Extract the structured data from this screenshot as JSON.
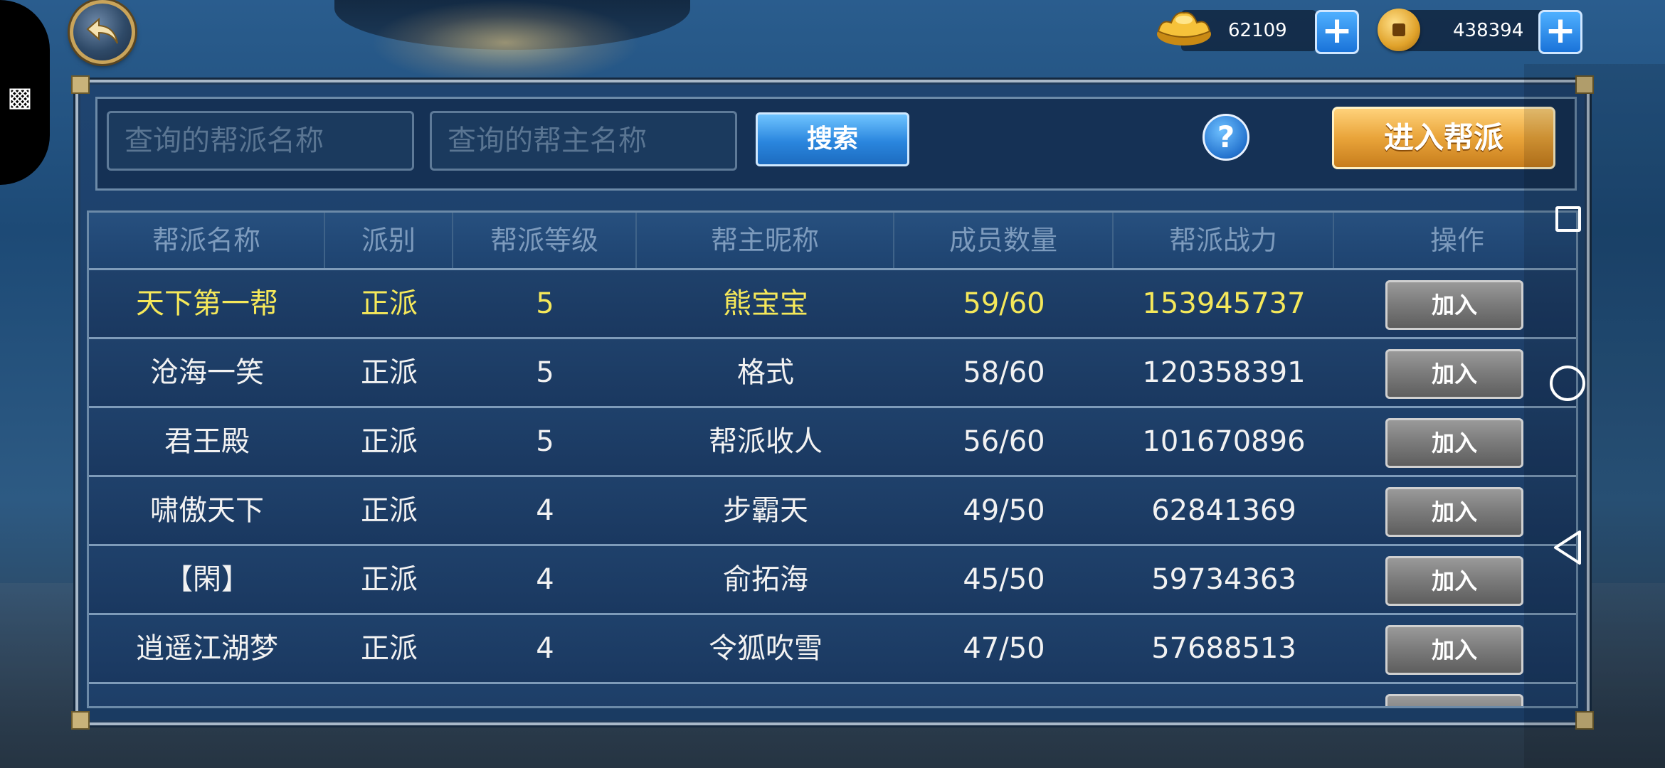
{
  "currencies": [
    {
      "name": "gold-ingot",
      "value": "62109"
    },
    {
      "name": "copper-coin",
      "value": "438394"
    }
  ],
  "search": {
    "guild_name_placeholder": "查询的帮派名称",
    "leader_name_placeholder": "查询的帮主名称",
    "search_label": "搜索",
    "help_label": "?",
    "enter_label": "进入帮派"
  },
  "table": {
    "headers": [
      "帮派名称",
      "派别",
      "帮派等级",
      "帮主昵称",
      "成员数量",
      "帮派战力",
      "操作"
    ],
    "rows": [
      {
        "name": "天下第一帮",
        "faction": "正派",
        "level": "5",
        "leader": "熊宝宝",
        "members": "59/60",
        "power": "153945737",
        "action": "加入"
      },
      {
        "name": "沧海一笑",
        "faction": "正派",
        "level": "5",
        "leader": "格式",
        "members": "58/60",
        "power": "120358391",
        "action": "加入"
      },
      {
        "name": "君王殿",
        "faction": "正派",
        "level": "5",
        "leader": "帮派收人",
        "members": "56/60",
        "power": "101670896",
        "action": "加入"
      },
      {
        "name": "啸傲天下",
        "faction": "正派",
        "level": "4",
        "leader": "步霸天",
        "members": "49/50",
        "power": "62841369",
        "action": "加入"
      },
      {
        "name": "【閑】",
        "faction": "正派",
        "level": "4",
        "leader": "俞拓海",
        "members": "45/50",
        "power": "59734363",
        "action": "加入"
      },
      {
        "name": "逍遥江湖梦",
        "faction": "正派",
        "level": "4",
        "leader": "令狐吹雪",
        "members": "47/50",
        "power": "57688513",
        "action": "加入"
      }
    ]
  },
  "colors": {
    "highlight_row_text": "#f5e85a",
    "panel_bg": "#1f4470",
    "enter_button": "#e9a43a",
    "search_button": "#2a86de"
  }
}
